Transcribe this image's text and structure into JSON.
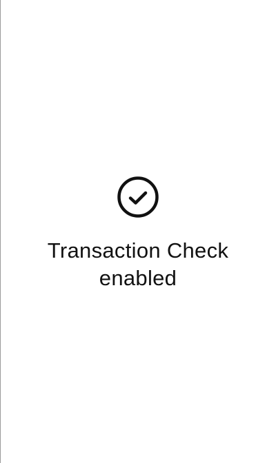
{
  "confirmation": {
    "icon": "check-circle-icon",
    "message": "Transaction Check enabled"
  },
  "colors": {
    "background": "#ffffff",
    "text": "#111111",
    "icon_stroke": "#111111",
    "left_edge": "#9a9a9a"
  }
}
